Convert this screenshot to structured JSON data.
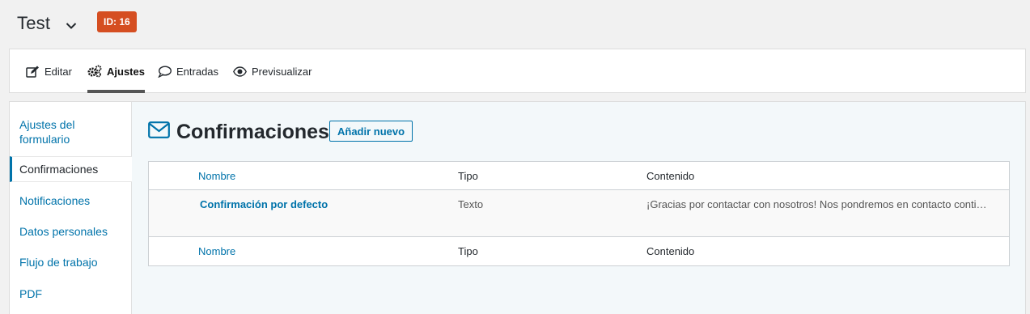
{
  "header": {
    "form_title": "Test",
    "id_badge": "ID: 16",
    "badge_color": "#d54e21"
  },
  "toolbar": {
    "items": [
      {
        "label": "Editar",
        "icon": "edit-icon"
      },
      {
        "label": "Ajustes",
        "icon": "gears-icon",
        "active": true
      },
      {
        "label": "Entradas",
        "icon": "comment-icon"
      },
      {
        "label": "Previsualizar",
        "icon": "eye-icon"
      }
    ]
  },
  "sidebar": {
    "items": [
      {
        "label": "Ajustes del formulario"
      },
      {
        "label": "Confirmaciones",
        "active": true
      },
      {
        "label": "Notificaciones"
      },
      {
        "label": "Datos personales"
      },
      {
        "label": "Flujo de trabajo"
      },
      {
        "label": "PDF"
      }
    ]
  },
  "main": {
    "title": "Confirmaciones",
    "title_icon": "envelope-icon",
    "add_new_label": "Añadir nuevo",
    "table": {
      "columns": [
        "Nombre",
        "Tipo",
        "Contenido"
      ],
      "rows": [
        {
          "name": "Confirmación por defecto",
          "type": "Texto",
          "content": "¡Gracias por contactar con nosotros! Nos pondremos en contacto conti…"
        }
      ]
    }
  },
  "colors": {
    "accent": "#0073aa",
    "panel_bg": "#f3f8fa",
    "page_bg": "#f1f1f1"
  }
}
